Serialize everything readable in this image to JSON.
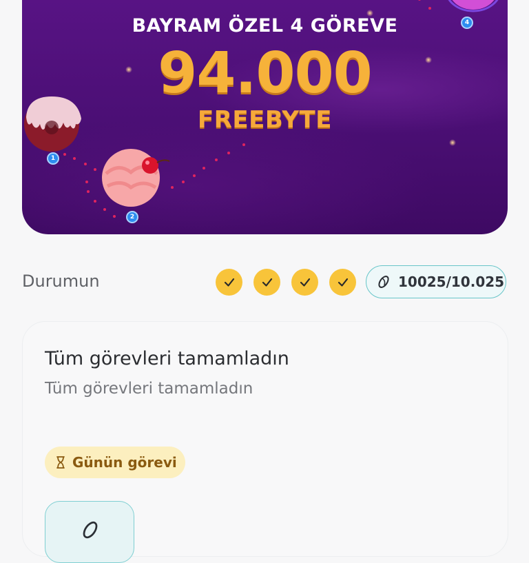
{
  "banner": {
    "line1": "BAYRAM ÖZEL 4 GÖREVE",
    "amount": "94.000",
    "unit": "FREEBYTE",
    "markers": [
      "1",
      "2",
      "4"
    ]
  },
  "status": {
    "label": "Durumun",
    "checks": [
      true,
      true,
      true,
      true
    ],
    "score": "10025/10.025"
  },
  "card": {
    "title": "Tüm görevleri tamamladın",
    "subtitle": "Tüm görevleri tamamladın",
    "badge": "Günün görevi"
  },
  "colors": {
    "banner_purple": "#4b0f75",
    "amount_gold": "#f6b23a",
    "check_yellow": "#f8c43a",
    "pill_teal": "#67c5c8",
    "badge_bg": "#fcefbf"
  },
  "icons": [
    "check-icon",
    "coin-icon",
    "hourglass-icon",
    "candy-planet-icon",
    "cupcake-planet-icon"
  ]
}
